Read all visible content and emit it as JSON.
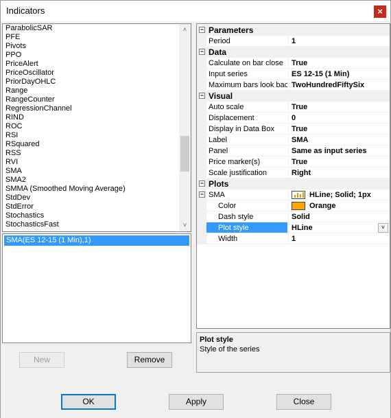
{
  "window": {
    "title": "Indicators",
    "close_glyph": "×"
  },
  "indicator_list": {
    "items": [
      "ParabolicSAR",
      "PFE",
      "Pivots",
      "PPO",
      "PriceAlert",
      "PriceOscillator",
      "PriorDayOHLC",
      "Range",
      "RangeCounter",
      "RegressionChannel",
      "RIND",
      "ROC",
      "RSI",
      "RSquared",
      "RSS",
      "RVI",
      "SMA",
      "SMA2",
      "SMMA (Smoothed Moving Average)",
      "StdDev",
      "StdError",
      "Stochastics",
      "StochasticsFast"
    ]
  },
  "configured": {
    "items": [
      "SMA(ES 12-15 (1 Min),1)"
    ]
  },
  "buttons": {
    "new": "New",
    "remove": "Remove",
    "ok": "OK",
    "apply": "Apply",
    "close": "Close"
  },
  "properties": {
    "parameters": {
      "label": "Parameters",
      "period_name": "Period",
      "period_value": "1"
    },
    "data": {
      "label": "Data",
      "calc_name": "Calculate on bar close",
      "calc_value": "True",
      "input_name": "Input series",
      "input_value": "ES 12-15 (1 Min)",
      "maxbars_name": "Maximum bars look bac",
      "maxbars_value": "TwoHundredFiftySix"
    },
    "visual": {
      "label": "Visual",
      "autoscale_name": "Auto scale",
      "autoscale_value": "True",
      "displacement_name": "Displacement",
      "displacement_value": "0",
      "databox_name": "Display in Data Box",
      "databox_value": "True",
      "label_name": "Label",
      "label_value": "SMA",
      "panel_name": "Panel",
      "panel_value": "Same as input series",
      "pricemarker_name": "Price marker(s)",
      "pricemarker_value": "True",
      "scalejust_name": "Scale justification",
      "scalejust_value": "Right"
    },
    "plots": {
      "label": "Plots",
      "sma_name": "SMA",
      "sma_value": "HLine; Solid; 1px",
      "color_name": "Color",
      "color_value": "Orange",
      "color_hex": "#ffa500",
      "dash_name": "Dash style",
      "dash_value": "Solid",
      "plotstyle_name": "Plot style",
      "plotstyle_value": "HLine",
      "width_name": "Width",
      "width_value": "1"
    }
  },
  "help": {
    "title": "Plot style",
    "description": "Style of the series"
  }
}
